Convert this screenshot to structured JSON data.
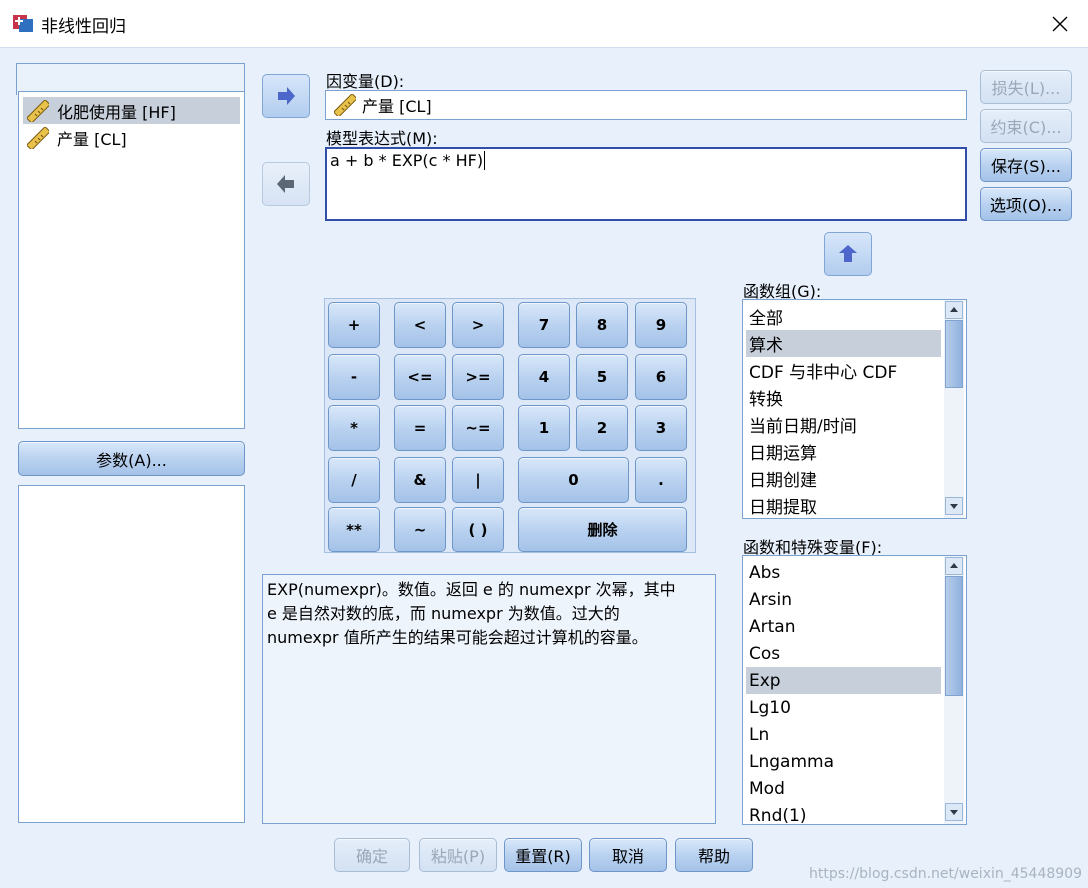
{
  "window": {
    "title": "非线性回归"
  },
  "variables": [
    {
      "label": "化肥使用量 [HF]",
      "selected": true
    },
    {
      "label": "产量 [CL]",
      "selected": false
    }
  ],
  "params_button": "参数(A)...",
  "dependent": {
    "label": "因变量(D):",
    "value": "产量 [CL]"
  },
  "model": {
    "label": "模型表达式(M):",
    "value": "a + b * EXP(c * HF)"
  },
  "side_buttons": {
    "loss": "损失(L)...",
    "constraints": "约束(C)...",
    "save": "保存(S)...",
    "options": "选项(O)..."
  },
  "keypad": {
    "plus": "+",
    "lt": "<",
    "gt": ">",
    "seven": "7",
    "eight": "8",
    "nine": "9",
    "minus": "-",
    "le": "<=",
    "ge": ">=",
    "four": "4",
    "five": "5",
    "six": "6",
    "mult": "*",
    "eq": "=",
    "ne": "~=",
    "one": "1",
    "two": "2",
    "three": "3",
    "div": "/",
    "and": "&",
    "or": "|",
    "zero": "0",
    "dot": ".",
    "pow": "**",
    "not": "~",
    "paren": "( )",
    "delete": "删除"
  },
  "description": "EXP(numexpr)。数值。返回 e 的 numexpr 次幂，其中\ne 是自然对数的底，而 numexpr 为数值。过大的\nnumexpr 值所产生的结果可能会超过计算机的容量。",
  "function_group": {
    "label": "函数组(G):",
    "items": [
      "全部",
      "算术",
      "CDF 与非中心 CDF",
      "转换",
      "当前日期/时间",
      "日期运算",
      "日期创建",
      "日期提取"
    ],
    "selected": "算术"
  },
  "functions": {
    "label": "函数和特殊变量(F):",
    "items": [
      "Abs",
      "Arsin",
      "Artan",
      "Cos",
      "Exp",
      "Lg10",
      "Ln",
      "Lngamma",
      "Mod",
      "Rnd(1)"
    ],
    "selected": "Exp"
  },
  "bottom_buttons": {
    "ok": "确定",
    "paste": "粘贴(P)",
    "reset": "重置(R)",
    "cancel": "取消",
    "help": "帮助"
  },
  "watermark": "https://blog.csdn.net/weixin_45448909",
  "colors": {
    "accent": "#7aa1cf",
    "background": "#e7f0fb",
    "selection": "#c7cfda"
  }
}
